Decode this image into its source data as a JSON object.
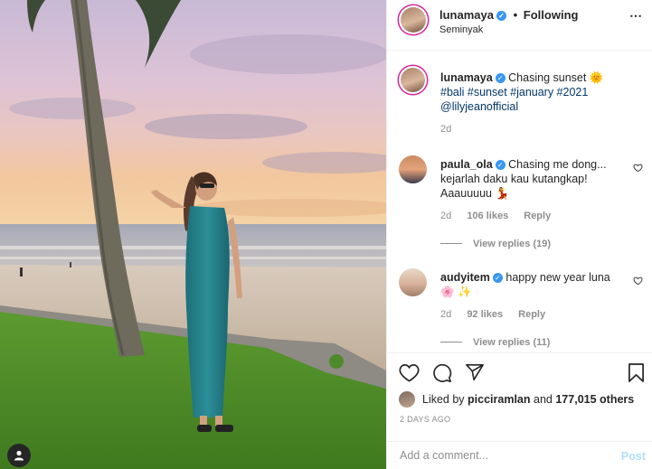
{
  "post": {
    "username": "lunamaya",
    "follow_status": "Following",
    "dot": "•",
    "location": "Seminyak",
    "more_icon": "⋯"
  },
  "caption": {
    "username": "lunamaya",
    "text": "Chasing sunset 🌞",
    "hashtags": "#bali #sunset #january #2021",
    "mention": "@lilyjeanofficial",
    "time": "2d"
  },
  "comments": [
    {
      "username": "paula_ola",
      "text": "Chasing me dong... kejarlah daku kau kutangkap! Aaauuuuu 💃",
      "time": "2d",
      "likes": "106 likes",
      "reply": "Reply",
      "view_replies": "View replies (19)"
    },
    {
      "username": "audyitem",
      "text": "happy new year luna 🌸 ✨",
      "time": "2d",
      "likes": "92 likes",
      "reply": "Reply",
      "view_replies": "View replies (11)"
    }
  ],
  "likes": {
    "prefix": "Liked by",
    "user": "picciramlan",
    "and": "and",
    "count": "177,015 others"
  },
  "timestamp": "2 DAYS AGO",
  "add_comment": {
    "placeholder": "Add a comment...",
    "post_label": "Post"
  },
  "colors": {
    "verified": "#3897f0",
    "link": "#00376b",
    "muted": "#8e8e8e",
    "post_button": "#b2dffc"
  }
}
